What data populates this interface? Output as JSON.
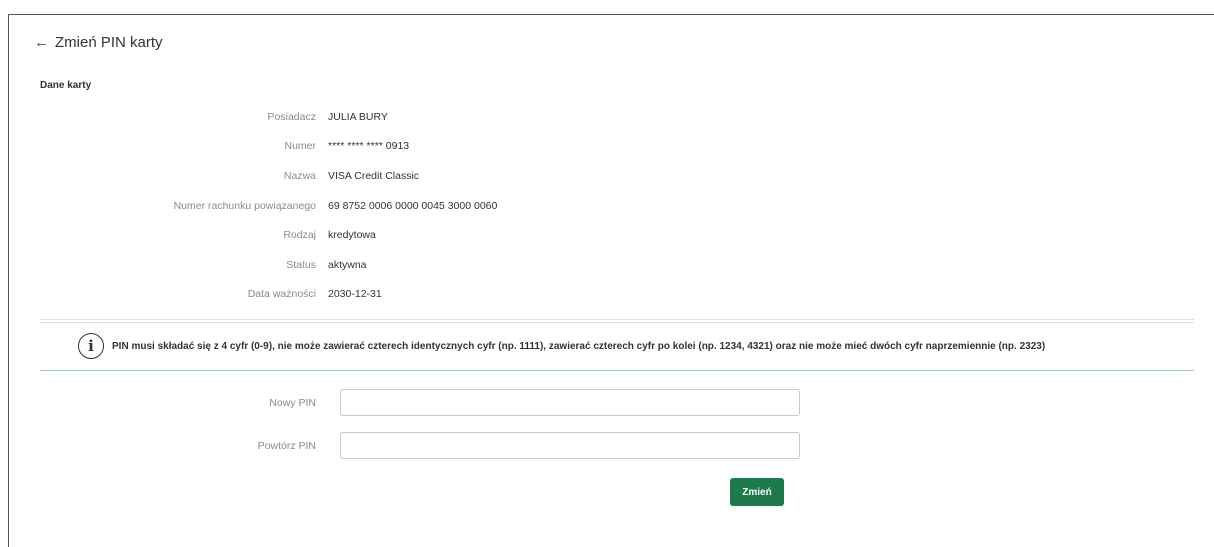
{
  "header": {
    "back_icon": "←",
    "title": "Zmień PIN karty"
  },
  "card_section": {
    "title": "Dane karty",
    "fields": [
      {
        "label": "Posiadacz",
        "value": "JULIA BURY"
      },
      {
        "label": "Numer",
        "value": "**** **** **** 0913"
      },
      {
        "label": "Nazwa",
        "value": "VISA Credit Classic"
      },
      {
        "label": "Numer rachunku powiązanego",
        "value": "69 8752 0006 0000 0045 3000 0060"
      },
      {
        "label": "Rodzaj",
        "value": "kredytowa"
      },
      {
        "label": "Status",
        "value": "aktywna"
      },
      {
        "label": "Data ważności",
        "value": "2030-12-31"
      }
    ]
  },
  "info": {
    "icon": "i",
    "text": "PIN musi składać się z 4 cyfr (0-9), nie może zawierać czterech identycznych cyfr (np. 1111), zawierać czterech cyfr po kolei (np. 1234, 4321) oraz nie może mieć dwóch cyfr naprzemiennie (np. 2323)"
  },
  "form": {
    "new_pin_label": "Nowy PIN",
    "new_pin_value": "",
    "repeat_pin_label": "Powtórz PIN",
    "repeat_pin_value": "",
    "submit_label": "Zmień"
  },
  "colors": {
    "accent": "#1d7a4b",
    "divider": "#9ccab5"
  }
}
